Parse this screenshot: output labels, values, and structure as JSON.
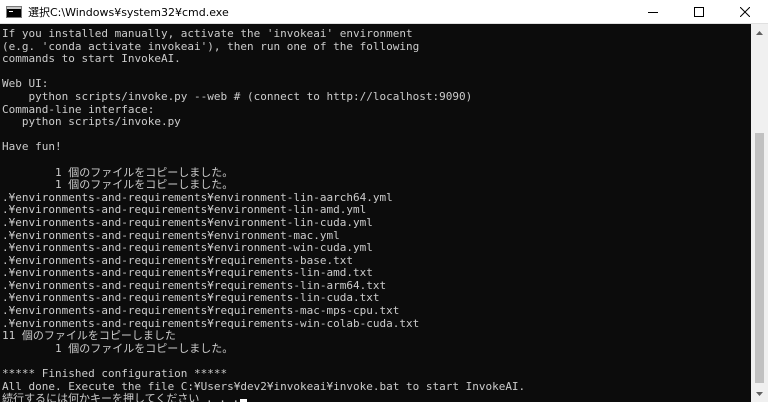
{
  "window": {
    "title": "選択C:\\Windows¥system32¥cmd.exe",
    "icons": {
      "app": "console-app-icon",
      "minimize": "minimize-icon",
      "maximize": "maximize-icon",
      "close": "close-icon"
    }
  },
  "console": {
    "lines": [
      "If you installed manually, activate the 'invokeai' environment",
      "(e.g. 'conda activate invokeai'), then run one of the following",
      "commands to start InvokeAI.",
      "",
      "Web UI:",
      "    python scripts/invoke.py --web # (connect to http://localhost:9090)",
      "Command-line interface:",
      "   python scripts/invoke.py",
      "",
      "Have fun!",
      "",
      "        1 個のファイルをコピーしました。",
      "        1 個のファイルをコピーしました。",
      ".¥environments-and-requirements¥environment-lin-aarch64.yml",
      ".¥environments-and-requirements¥environment-lin-amd.yml",
      ".¥environments-and-requirements¥environment-lin-cuda.yml",
      ".¥environments-and-requirements¥environment-mac.yml",
      ".¥environments-and-requirements¥environment-win-cuda.yml",
      ".¥environments-and-requirements¥requirements-base.txt",
      ".¥environments-and-requirements¥requirements-lin-amd.txt",
      ".¥environments-and-requirements¥requirements-lin-arm64.txt",
      ".¥environments-and-requirements¥requirements-lin-cuda.txt",
      ".¥environments-and-requirements¥requirements-mac-mps-cpu.txt",
      ".¥environments-and-requirements¥requirements-win-colab-cuda.txt",
      "11 個のファイルをコピーしました",
      "        1 個のファイルをコピーしました。",
      "",
      "***** Finished configuration *****",
      "All done. Execute the file C:¥Users¥dev2¥invokeai¥invoke.bat to start InvokeAI.",
      "続行するには何かキーを押してください . . ."
    ]
  },
  "colors": {
    "console_bg": "#0c0c0c",
    "console_text": "#cccccc",
    "titlebar_bg": "#ffffff"
  }
}
